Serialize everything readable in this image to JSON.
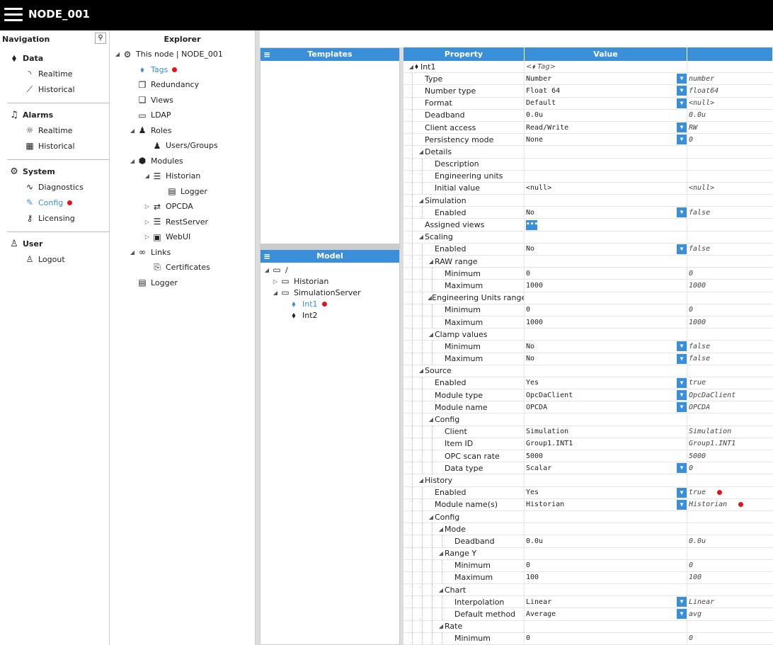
{
  "app": {
    "title": "NODE_001"
  },
  "navigation": {
    "header": "Navigation",
    "groups": [
      {
        "title": "Data",
        "icon": "tag-icon",
        "items": [
          {
            "label": "Realtime",
            "icon": "rss-icon"
          },
          {
            "label": "Historical",
            "icon": "line-chart-icon"
          }
        ]
      },
      {
        "title": "Alarms",
        "icon": "bell-icon",
        "items": [
          {
            "label": "Realtime",
            "icon": "alarm-light-icon"
          },
          {
            "label": "Historical",
            "icon": "table-icon"
          }
        ]
      },
      {
        "title": "System",
        "icon": "gear-icon",
        "items": [
          {
            "label": "Diagnostics",
            "icon": "pulse-icon"
          },
          {
            "label": "Config",
            "icon": "edit-icon",
            "active": true,
            "modified": true
          },
          {
            "label": "Licensing",
            "icon": "key-icon"
          }
        ]
      },
      {
        "title": "User",
        "icon": "user-icon",
        "items": [
          {
            "label": "Logout",
            "icon": "user-x-icon"
          }
        ]
      }
    ]
  },
  "explorer": {
    "header": "Explorer",
    "nodes": [
      {
        "label": "This node | NODE_001",
        "depth": 0,
        "expander": "expanded",
        "icon": "gears-icon"
      },
      {
        "label": "Tags",
        "depth": 1,
        "expander": "none",
        "icon": "tag-icon",
        "active": true,
        "modified": true
      },
      {
        "label": "Redundancy",
        "depth": 1,
        "expander": "none",
        "icon": "copy-icon"
      },
      {
        "label": "Views",
        "depth": 1,
        "expander": "none",
        "icon": "windows-icon"
      },
      {
        "label": "LDAP",
        "depth": 1,
        "expander": "none",
        "icon": "id-card-icon"
      },
      {
        "label": "Roles",
        "depth": 1,
        "expander": "expanded",
        "icon": "users-icon"
      },
      {
        "label": "Users/Groups",
        "depth": 2,
        "expander": "none",
        "icon": "users-icon"
      },
      {
        "label": "Modules",
        "depth": 1,
        "expander": "expanded",
        "icon": "cubes-icon"
      },
      {
        "label": "Historian",
        "depth": 2,
        "expander": "expanded",
        "icon": "database-icon"
      },
      {
        "label": "Logger",
        "depth": 3,
        "expander": "none",
        "icon": "log-icon"
      },
      {
        "label": "OPCDA",
        "depth": 2,
        "expander": "collapsed",
        "icon": "arrows-icon"
      },
      {
        "label": "RestServer",
        "depth": 2,
        "expander": "collapsed",
        "icon": "server-icon"
      },
      {
        "label": "WebUI",
        "depth": 2,
        "expander": "collapsed",
        "icon": "browser-icon"
      },
      {
        "label": "Links",
        "depth": 1,
        "expander": "expanded",
        "icon": "link-icon"
      },
      {
        "label": "Certificates",
        "depth": 2,
        "expander": "none",
        "icon": "certificate-icon"
      },
      {
        "label": "Logger",
        "depth": 1,
        "expander": "none",
        "icon": "log-icon"
      }
    ]
  },
  "templates": {
    "header": "Templates"
  },
  "model": {
    "header": "Model",
    "nodes": [
      {
        "label": "/",
        "depth": 0,
        "expander": "expanded",
        "icon": "folder-icon"
      },
      {
        "label": "Historian",
        "depth": 1,
        "expander": "collapsed",
        "icon": "folder-icon"
      },
      {
        "label": "SimulationServer",
        "depth": 1,
        "expander": "expanded",
        "icon": "folder-icon"
      },
      {
        "label": "Int1",
        "depth": 2,
        "expander": "none",
        "icon": "tag-icon",
        "active": true,
        "modified": true
      },
      {
        "label": "Int2",
        "depth": 2,
        "expander": "none",
        "icon": "tag-icon"
      }
    ]
  },
  "grid": {
    "headers": {
      "property": "Property",
      "value": "Value",
      "extra": ""
    },
    "rows": [
      {
        "label": "Int1",
        "depth": 0,
        "exp": "expanded",
        "icon": "tag-icon",
        "value": "Tag",
        "valueIcon": "tag-icon",
        "placeholder": true,
        "raw": ""
      },
      {
        "label": "Type",
        "depth": 1,
        "value": "Number",
        "dropdown": true,
        "raw": "number"
      },
      {
        "label": "Number type",
        "depth": 1,
        "value": "Float 64",
        "dropdown": true,
        "raw": "float64"
      },
      {
        "label": "Format",
        "depth": 1,
        "value": "Default",
        "dropdown": true,
        "raw": "<null>"
      },
      {
        "label": "Deadband",
        "depth": 1,
        "value": "0.0u",
        "raw": "0.0u"
      },
      {
        "label": "Client access",
        "depth": 1,
        "value": "Read/Write",
        "dropdown": true,
        "raw": "RW"
      },
      {
        "label": "Persistency mode",
        "depth": 1,
        "value": "None",
        "dropdown": true,
        "raw": "0"
      },
      {
        "label": "Details",
        "depth": 1,
        "exp": "expanded",
        "value": "",
        "raw": ""
      },
      {
        "label": "Description",
        "depth": 2,
        "value": "",
        "raw": ""
      },
      {
        "label": "Engineering units",
        "depth": 2,
        "value": "",
        "raw": ""
      },
      {
        "label": "Initial value",
        "depth": 2,
        "value": "<null>",
        "raw": "<null>"
      },
      {
        "label": "Simulation",
        "depth": 1,
        "exp": "expanded",
        "value": "",
        "raw": ""
      },
      {
        "label": "Enabled",
        "depth": 2,
        "value": "No",
        "dropdown": true,
        "raw": "false"
      },
      {
        "label": "Assigned views",
        "depth": 1,
        "value": "",
        "ellipsis": true,
        "raw": ""
      },
      {
        "label": "Scaling",
        "depth": 1,
        "exp": "expanded",
        "value": "",
        "raw": ""
      },
      {
        "label": "Enabled",
        "depth": 2,
        "value": "No",
        "dropdown": true,
        "raw": "false"
      },
      {
        "label": "RAW range",
        "depth": 2,
        "exp": "expanded",
        "value": "",
        "raw": ""
      },
      {
        "label": "Minimum",
        "depth": 3,
        "value": "0",
        "raw": "0"
      },
      {
        "label": "Maximum",
        "depth": 3,
        "value": "1000",
        "raw": "1000"
      },
      {
        "label": "Engineering Units range",
        "depth": 2,
        "exp": "expanded",
        "value": "",
        "raw": ""
      },
      {
        "label": "Minimum",
        "depth": 3,
        "value": "0",
        "raw": "0"
      },
      {
        "label": "Maximum",
        "depth": 3,
        "value": "1000",
        "raw": "1000"
      },
      {
        "label": "Clamp values",
        "depth": 2,
        "exp": "expanded",
        "value": "",
        "raw": ""
      },
      {
        "label": "Minimum",
        "depth": 3,
        "value": "No",
        "dropdown": true,
        "raw": "false"
      },
      {
        "label": "Maximum",
        "depth": 3,
        "value": "No",
        "dropdown": true,
        "raw": "false"
      },
      {
        "label": "Source",
        "depth": 1,
        "exp": "expanded",
        "value": "",
        "raw": ""
      },
      {
        "label": "Enabled",
        "depth": 2,
        "value": "Yes",
        "dropdown": true,
        "raw": "true"
      },
      {
        "label": "Module type",
        "depth": 2,
        "value": "OpcDaClient",
        "dropdown": true,
        "raw": "OpcDaClient"
      },
      {
        "label": "Module name",
        "depth": 2,
        "value": "OPCDA",
        "dropdown": true,
        "raw": "OPCDA"
      },
      {
        "label": "Config",
        "depth": 2,
        "exp": "expanded",
        "value": "",
        "raw": ""
      },
      {
        "label": "Client",
        "depth": 3,
        "value": "Simulation",
        "raw": "Simulation"
      },
      {
        "label": "Item ID",
        "depth": 3,
        "value": "Group1.INT1",
        "raw": "Group1.INT1"
      },
      {
        "label": "OPC scan rate",
        "depth": 3,
        "value": "5000",
        "raw": "5000"
      },
      {
        "label": "Data type",
        "depth": 3,
        "value": "Scalar",
        "dropdown": true,
        "raw": "0"
      },
      {
        "label": "History",
        "depth": 1,
        "exp": "expanded",
        "value": "",
        "raw": ""
      },
      {
        "label": "Enabled",
        "depth": 2,
        "value": "Yes",
        "dropdown": true,
        "raw": "true",
        "modified": true
      },
      {
        "label": "Module name(s)",
        "depth": 2,
        "value": "Historian",
        "dropdown": true,
        "raw": "Historian",
        "modified": true
      },
      {
        "label": "Config",
        "depth": 2,
        "exp": "expanded",
        "value": "",
        "raw": ""
      },
      {
        "label": "Mode",
        "depth": 3,
        "exp": "expanded",
        "value": "",
        "raw": ""
      },
      {
        "label": "Deadband",
        "depth": 4,
        "value": "0.0u",
        "raw": "0.0u"
      },
      {
        "label": "Range Y",
        "depth": 3,
        "exp": "expanded",
        "value": "",
        "raw": ""
      },
      {
        "label": "Minimum",
        "depth": 4,
        "value": "0",
        "raw": "0"
      },
      {
        "label": "Maximum",
        "depth": 4,
        "value": "100",
        "raw": "100"
      },
      {
        "label": "Chart",
        "depth": 3,
        "exp": "expanded",
        "value": "",
        "raw": ""
      },
      {
        "label": "Interpolation",
        "depth": 4,
        "value": "Linear",
        "dropdown": true,
        "raw": "Linear"
      },
      {
        "label": "Default method",
        "depth": 4,
        "value": "Average",
        "dropdown": true,
        "raw": "avg"
      },
      {
        "label": "Rate",
        "depth": 3,
        "exp": "expanded",
        "value": "",
        "raw": ""
      },
      {
        "label": "Minimum",
        "depth": 4,
        "value": "0",
        "raw": "0"
      }
    ]
  },
  "colors": {
    "accent": "#3b8fd8",
    "modified": "#e0151a",
    "topbar": "#000000"
  }
}
